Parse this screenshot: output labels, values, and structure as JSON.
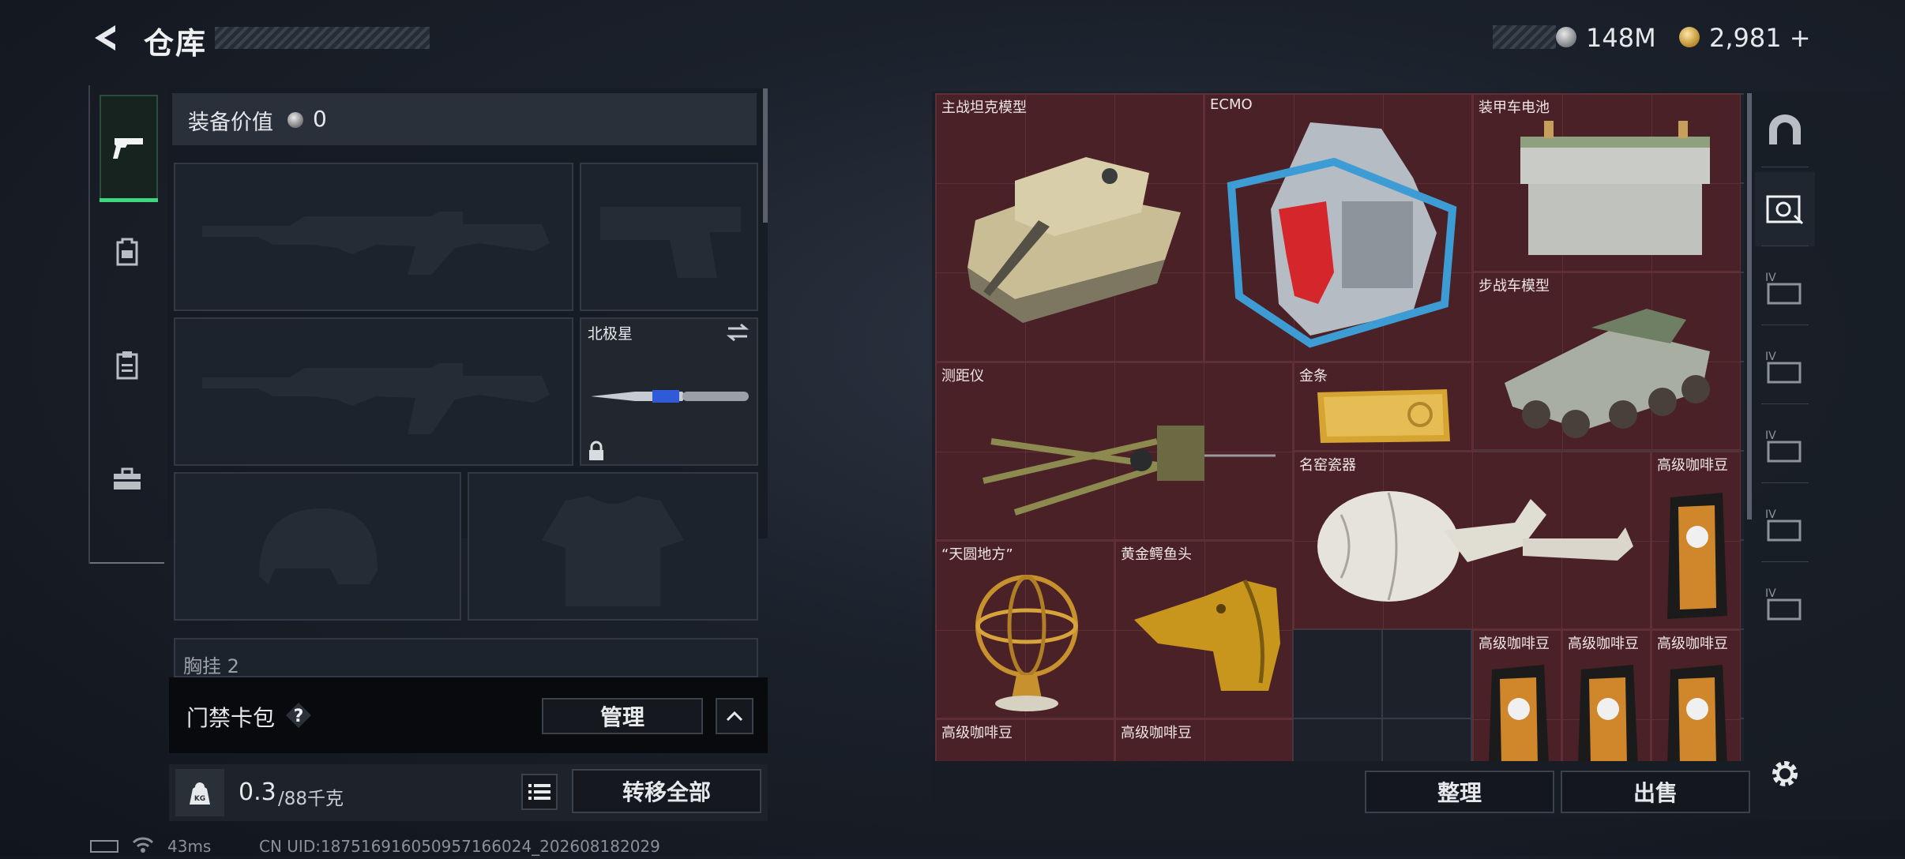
{
  "header": {
    "title": "仓库",
    "back_icon": "back-arrow-icon"
  },
  "currency": {
    "silver": "148M",
    "gold": "2,981",
    "gold_plus": "+"
  },
  "left_tabs": [
    {
      "icon": "pistol-icon",
      "active": true
    },
    {
      "icon": "backpack-icon",
      "active": false
    },
    {
      "icon": "clipboard-icon",
      "active": false
    },
    {
      "icon": "toolbox-icon",
      "active": false
    }
  ],
  "equipment": {
    "value_label": "装备价值",
    "value": "0",
    "melee_name": "北极星",
    "chest_label": "胸挂",
    "chest_count": "2"
  },
  "keycard": {
    "label": "门禁卡包",
    "help": "?",
    "manage": "管理"
  },
  "weight": {
    "value": "0.3",
    "max": "/88千克",
    "transfer_all": "转移全部",
    "kg_icon_text": "KG"
  },
  "status": {
    "ping": "43ms",
    "uid": "CN UID:18751691605095716602​4_202608182029"
  },
  "storage": {
    "items": [
      {
        "name": "主战坦克模型",
        "rarity_color": "#4a2127"
      },
      {
        "name": "ECMO",
        "rarity_color": "#4a2127"
      },
      {
        "name": "装甲车电池",
        "rarity_color": "#4a2127"
      },
      {
        "name": "步战车模型",
        "rarity_color": "#4a2127"
      },
      {
        "name": "测距仪",
        "rarity_color": "#4a2127"
      },
      {
        "name": "金条",
        "rarity_color": "#4a2127"
      },
      {
        "name": "名窑瓷器",
        "rarity_color": "#4a2127"
      },
      {
        "name": "高级咖啡豆",
        "rarity_color": "#4a2127"
      },
      {
        "name": "“天圆地方”",
        "rarity_color": "#4a2127"
      },
      {
        "name": "黄金鳄鱼头",
        "rarity_color": "#4a2127"
      },
      {
        "name": "高级咖啡豆",
        "rarity_color": "#4a2127"
      },
      {
        "name": "高级咖啡豆",
        "rarity_color": "#4a2127"
      },
      {
        "name": "高级咖啡豆",
        "rarity_color": "#4a2127"
      },
      {
        "name": "高级咖啡豆",
        "rarity_color": "#4a2127"
      },
      {
        "name": "高级咖啡豆",
        "rarity_color": "#4a2127"
      }
    ],
    "tabs": [
      "stash-arch-icon",
      "storage-crate-icon",
      "IV",
      "IV",
      "IV",
      "IV",
      "IV"
    ],
    "organize": "整理",
    "sell": "出售"
  },
  "colors": {
    "active_green": "#3fd680",
    "item_red": "#4a2127"
  }
}
